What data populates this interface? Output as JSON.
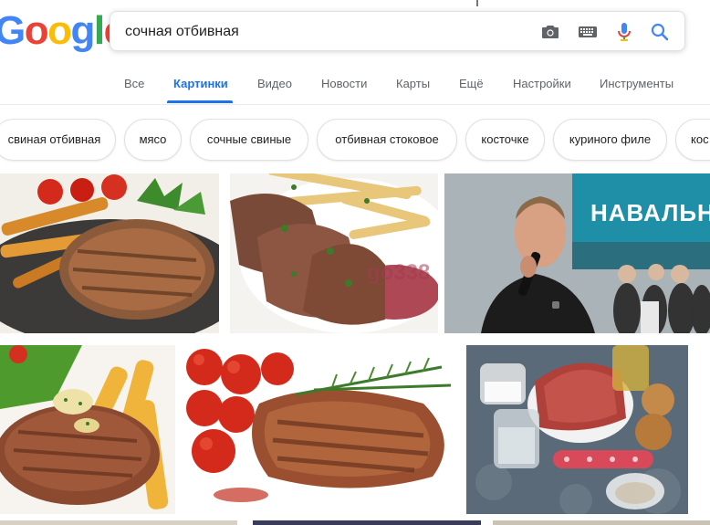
{
  "logo": {
    "text_letters": [
      "G",
      "o",
      "o",
      "g",
      "l",
      "e"
    ],
    "colors": [
      "#4285f4",
      "#ea4335",
      "#fbbc05",
      "#4285f4",
      "#34a853",
      "#ea4335"
    ]
  },
  "search": {
    "query": "сочная отбивная",
    "icons": [
      "camera-icon",
      "keyboard-icon",
      "mic-icon",
      "search-icon"
    ]
  },
  "tabs": [
    {
      "label": "Все",
      "active": false
    },
    {
      "label": "Картинки",
      "active": true
    },
    {
      "label": "Видео",
      "active": false
    },
    {
      "label": "Новости",
      "active": false
    },
    {
      "label": "Карты",
      "active": false
    },
    {
      "label": "Ещё",
      "active": false
    },
    {
      "label": "Настройки",
      "active": false
    },
    {
      "label": "Инструменты",
      "active": false
    }
  ],
  "chips": [
    "свиная отбивная",
    "мясо",
    "сочные свиные",
    "отбивная стоковое",
    "косточке",
    "куриного филе",
    "кос"
  ],
  "images": [
    {
      "subject": "grilled steak with fries and tomatoes"
    },
    {
      "subject": "sliced beef with potatoes and herbs",
      "watermark": "go338"
    },
    {
      "subject": "man speaking into microphone",
      "banner_text": "НАВАЛЬН"
    },
    {
      "subject": "steak with herb butter and fries"
    },
    {
      "subject": "grilled steak with cherry tomatoes and rosemary"
    },
    {
      "subject": "raw meat with onions, water and spices"
    }
  ],
  "colors": {
    "accent": "#1a73e8",
    "tab_text": "#5f6368",
    "border": "#dfe1e5"
  }
}
